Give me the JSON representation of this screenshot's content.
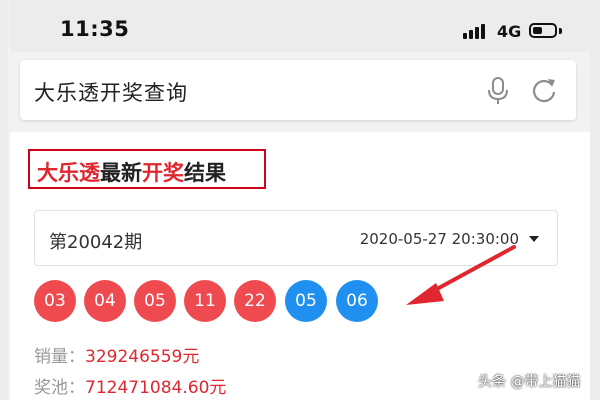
{
  "status_bar": {
    "time": "11:35",
    "network": "4G"
  },
  "search": {
    "query": "大乐透开奖查询",
    "icons": [
      "microphone-icon",
      "refresh-icon"
    ]
  },
  "result": {
    "title_parts": [
      "大乐透",
      "最新",
      "开奖",
      "结果"
    ],
    "issue": "第20042期",
    "date": "2020-05-27 20:30:00",
    "red_balls": [
      "03",
      "04",
      "05",
      "11",
      "22"
    ],
    "blue_balls": [
      "05",
      "06"
    ],
    "sales_label": "销量：",
    "sales_value": "329246559元",
    "pool_label": "奖池：",
    "pool_value": "712471084.60元"
  },
  "colors": {
    "red_ball": "#ef4a50",
    "blue_ball": "#1f8ff0",
    "highlight": "#e0262f",
    "annotation": "#e0262f"
  },
  "watermark": "头条 @带上猫猫"
}
